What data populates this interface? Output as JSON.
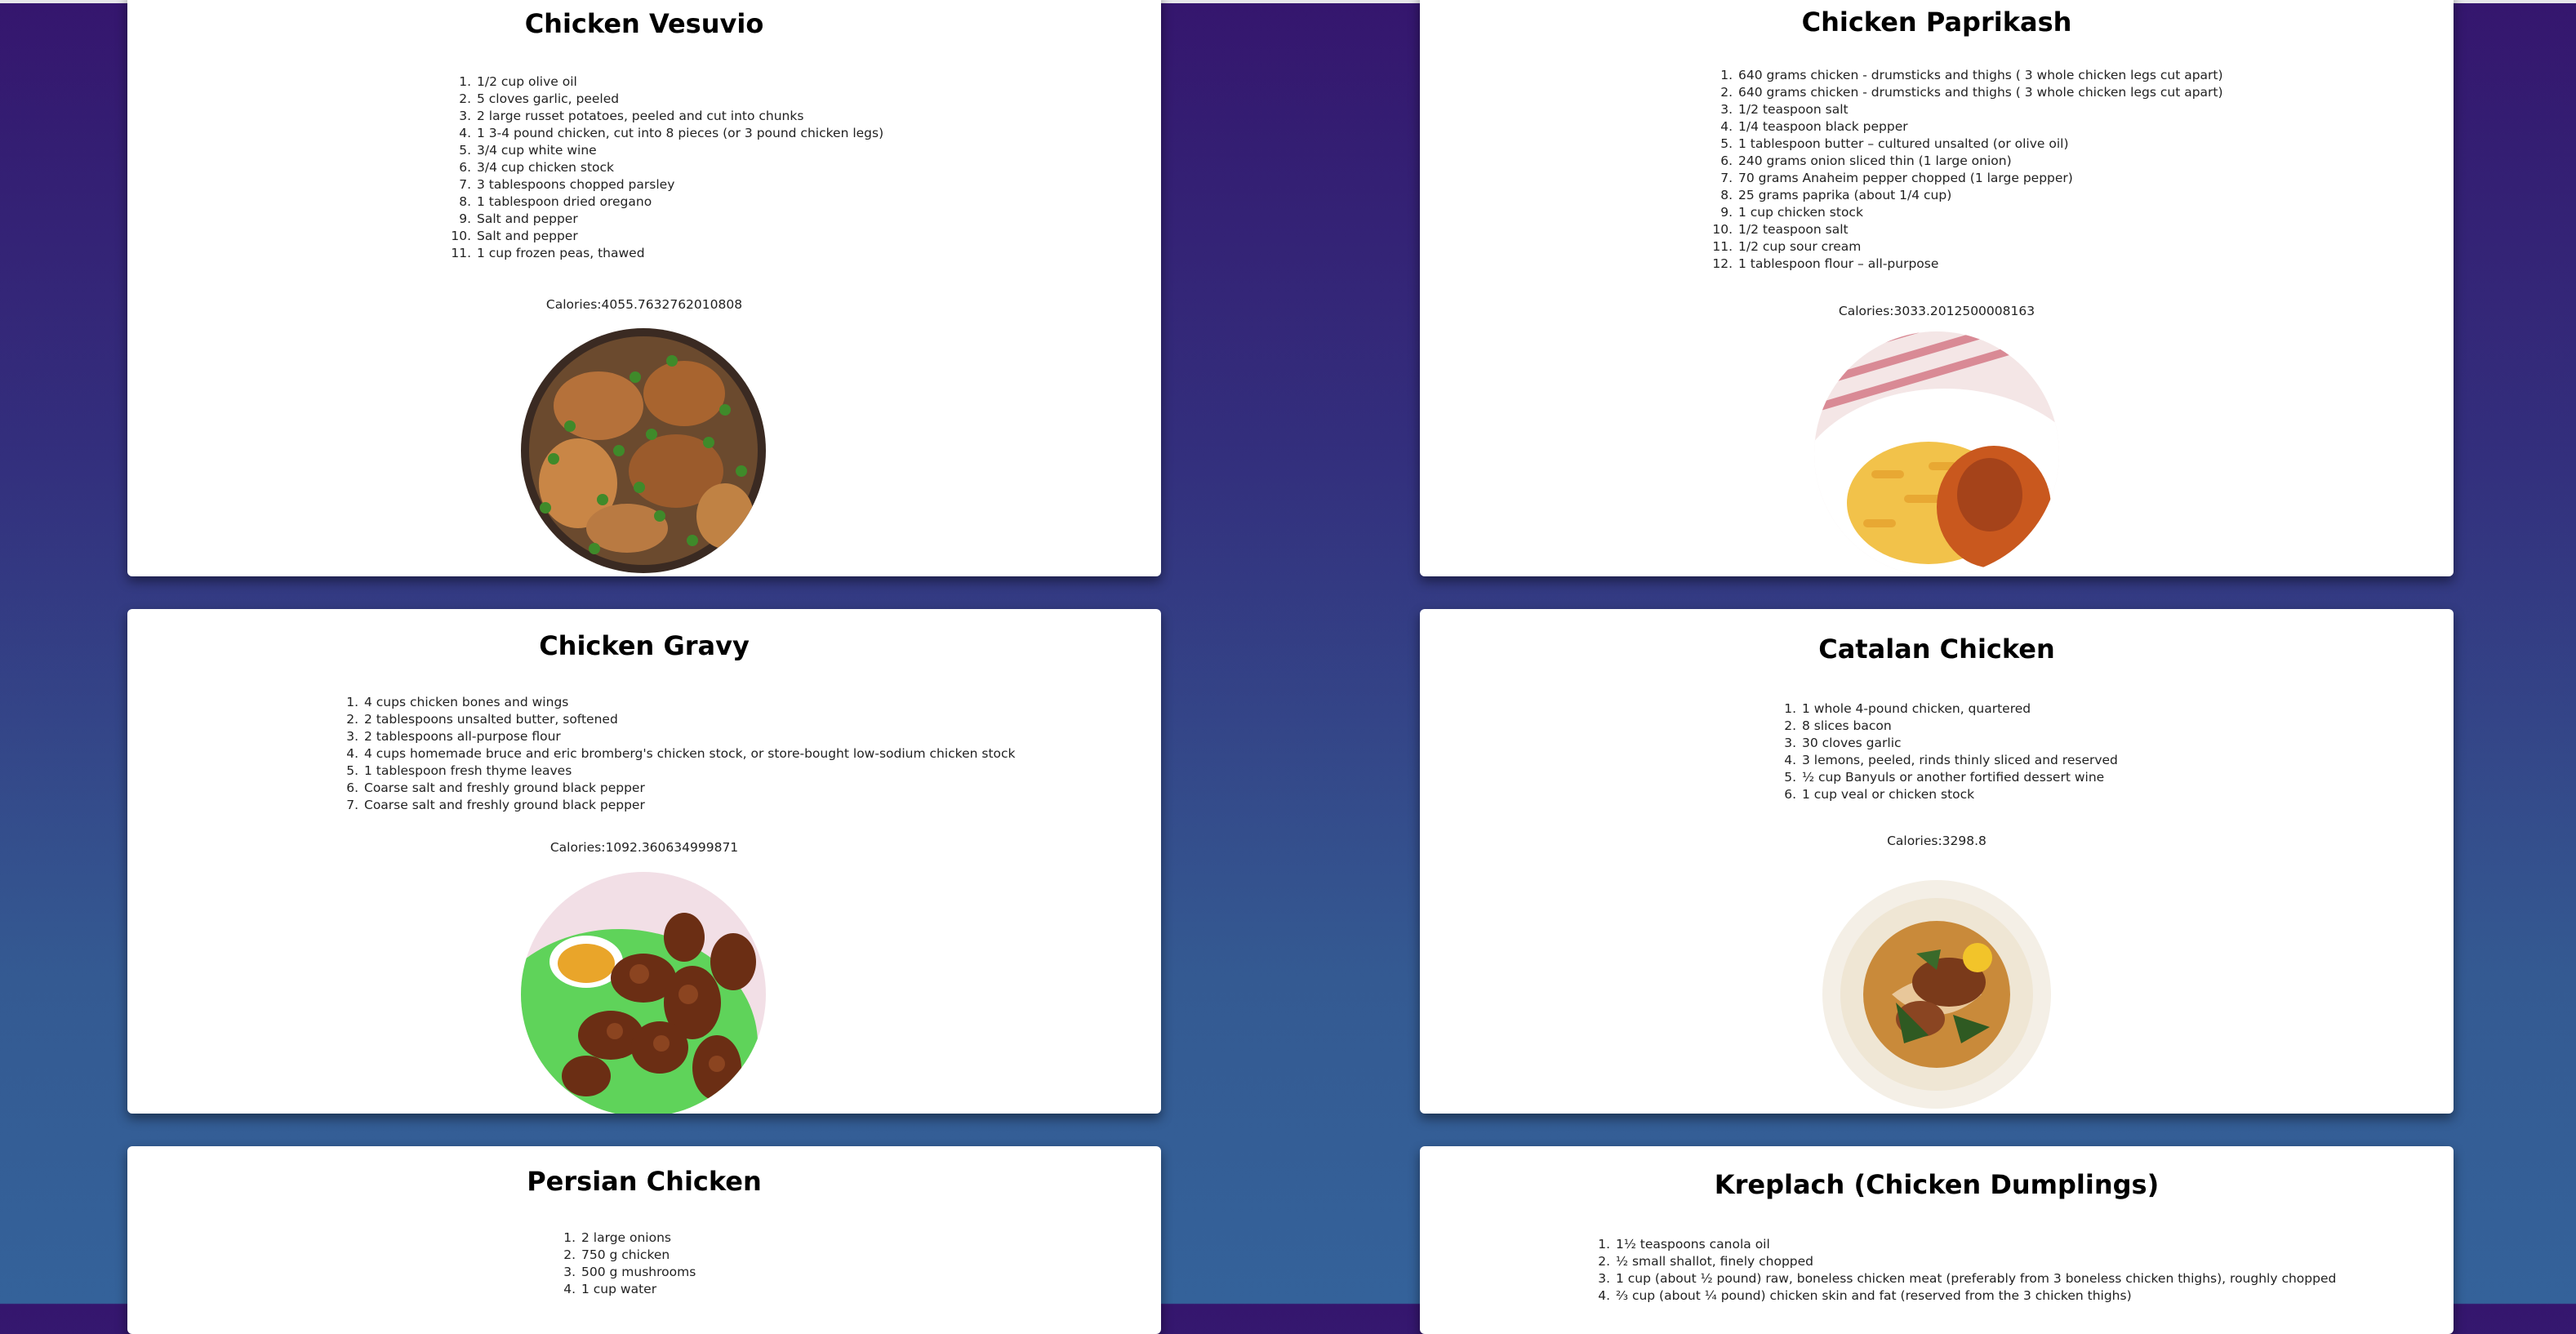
{
  "recipes": [
    {
      "title": "Chicken Vesuvio",
      "ingredients": [
        "1/2 cup olive oil",
        "5 cloves garlic, peeled",
        "2 large russet potatoes, peeled and cut into chunks",
        "1 3-4 pound chicken, cut into 8 pieces (or 3 pound chicken legs)",
        "3/4 cup white wine",
        "3/4 cup chicken stock",
        "3 tablespoons chopped parsley",
        "1 tablespoon dried oregano",
        "Salt and pepper",
        "Salt and pepper",
        "1 cup frozen peas, thawed"
      ],
      "calories": "Calories:4055.7632762010808",
      "image_icon": "chicken-vesuvio-photo"
    },
    {
      "title": "Chicken Paprikash",
      "ingredients": [
        "640 grams chicken - drumsticks and thighs ( 3 whole chicken legs cut apart)",
        "640 grams chicken - drumsticks and thighs ( 3 whole chicken legs cut apart)",
        "1/2 teaspoon salt",
        "1/4 teaspoon black pepper",
        "1 tablespoon butter – cultured unsalted (or olive oil)",
        "240 grams onion sliced thin (1 large onion)",
        "70 grams Anaheim pepper chopped (1 large pepper)",
        "25 grams paprika (about 1/4 cup)",
        "1 cup chicken stock",
        "1/2 teaspoon salt",
        "1/2 cup sour cream",
        "1 tablespoon flour – all-purpose"
      ],
      "calories": "Calories:3033.2012500008163",
      "image_icon": "chicken-paprikash-photo"
    },
    {
      "title": "Chicken Gravy",
      "ingredients": [
        "4 cups chicken bones and wings",
        "2 tablespoons unsalted butter, softened",
        "2 tablespoons all-purpose flour",
        "4 cups homemade bruce and eric bromberg's chicken stock, or store-bought low-sodium chicken stock",
        "1 tablespoon fresh thyme leaves",
        "Coarse salt and freshly ground black pepper",
        "Coarse salt and freshly ground black pepper"
      ],
      "calories": "Calories:1092.360634999871",
      "image_icon": "fried-chicken-photo"
    },
    {
      "title": "Catalan Chicken",
      "ingredients": [
        "1 whole 4-pound chicken, quartered",
        "8 slices bacon",
        "30 cloves garlic",
        "3 lemons, peeled, rinds thinly sliced and reserved",
        "½ cup Banyuls or another fortified dessert wine",
        "1 cup veal or chicken stock"
      ],
      "calories": "Calories:3298.8",
      "image_icon": "catalan-chicken-photo"
    },
    {
      "title": "Persian Chicken",
      "ingredients": [
        "2 large onions",
        "750 g chicken",
        "500 g mushrooms",
        "1 cup water"
      ],
      "calories": "",
      "image_icon": ""
    },
    {
      "title": "Kreplach (Chicken Dumplings)",
      "ingredients": [
        "1½ teaspoons canola oil",
        "½ small shallot, finely chopped",
        "1 cup (about ½ pound) raw, boneless chicken meat (preferably from 3 boneless chicken thighs), roughly chopped",
        "⅔ cup (about ¼ pound) chicken skin and fat (reserved from the 3 chicken thighs)"
      ],
      "calories": "",
      "image_icon": ""
    }
  ]
}
